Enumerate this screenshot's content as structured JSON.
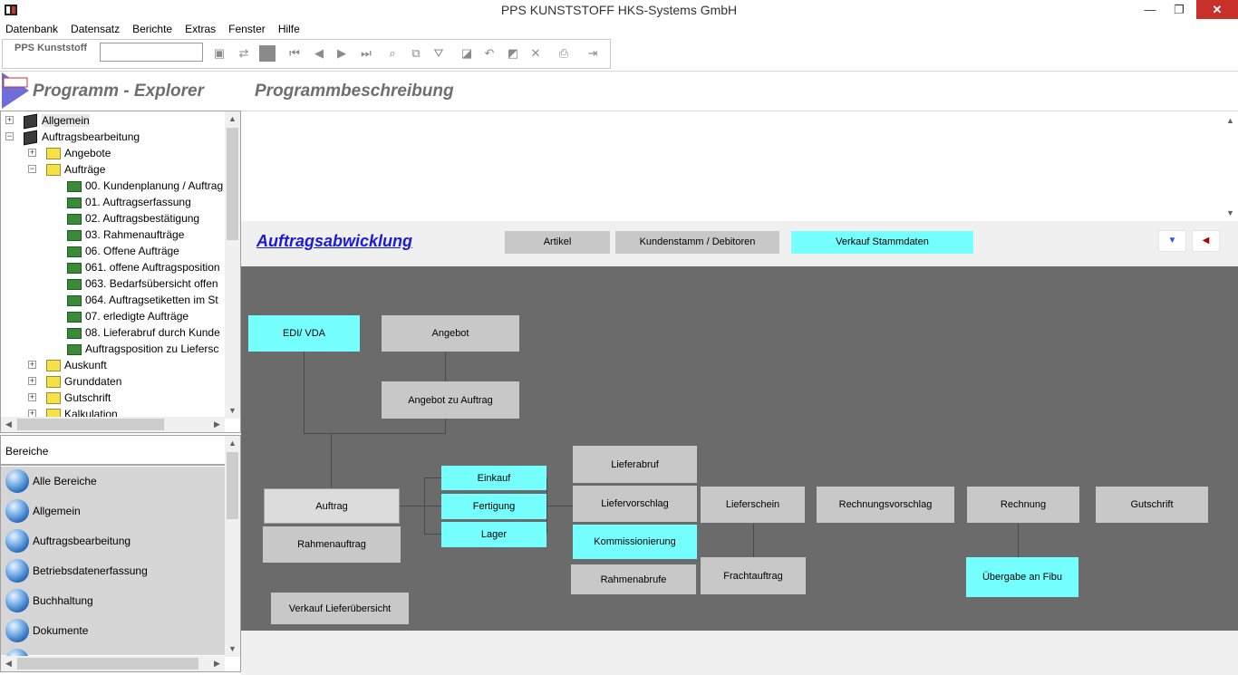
{
  "window": {
    "title": "PPS KUNSTSTOFF HKS-Systems GmbH",
    "minimize": "—",
    "maximize": "❐",
    "close": "✕"
  },
  "menu": [
    "Datenbank",
    "Datensatz",
    "Berichte",
    "Extras",
    "Fenster",
    "Hilfe"
  ],
  "toolbar": {
    "label": "PPS Kunststoff",
    "input_value": ""
  },
  "header": {
    "explorer_title": "Programm - Explorer",
    "description_title": "Programmbeschreibung"
  },
  "tree": [
    {
      "label": "Allgemein",
      "level": 0,
      "expander": "+",
      "icon": "book-icon",
      "selected": true
    },
    {
      "label": "Auftragsbearbeitung",
      "level": 0,
      "expander": "−",
      "icon": "book-icon"
    },
    {
      "label": "Angebote",
      "level": 1,
      "expander": "+",
      "icon": "folder-icon"
    },
    {
      "label": "Aufträge",
      "level": 1,
      "expander": "−",
      "icon": "folder-icon"
    },
    {
      "label": "00. Kundenplanung / Auftrag",
      "level": 2,
      "icon": "app-icon"
    },
    {
      "label": "01. Auftragserfassung",
      "level": 2,
      "icon": "app-icon"
    },
    {
      "label": "02. Auftragsbestätigung",
      "level": 2,
      "icon": "app-icon"
    },
    {
      "label": "03. Rahmenaufträge",
      "level": 2,
      "icon": "app-icon"
    },
    {
      "label": "06. Offene Aufträge",
      "level": 2,
      "icon": "app-icon"
    },
    {
      "label": "061. offene Auftragsposition",
      "level": 2,
      "icon": "app-icon"
    },
    {
      "label": "063. Bedarfsübersicht offen",
      "level": 2,
      "icon": "app-icon"
    },
    {
      "label": "064. Auftragsetiketten im St",
      "level": 2,
      "icon": "app-icon"
    },
    {
      "label": "07. erledigte Aufträge",
      "level": 2,
      "icon": "app-icon"
    },
    {
      "label": "08. Lieferabruf durch Kunde",
      "level": 2,
      "icon": "app-icon"
    },
    {
      "label": "Auftragsposition zu Liefersc",
      "level": 2,
      "icon": "app-icon"
    },
    {
      "label": "Auskunft",
      "level": 1,
      "expander": "+",
      "icon": "folder-icon"
    },
    {
      "label": "Grunddaten",
      "level": 1,
      "expander": "+",
      "icon": "folder-icon"
    },
    {
      "label": "Gutschrift",
      "level": 1,
      "expander": "+",
      "icon": "folder-icon"
    },
    {
      "label": "Kalkulation",
      "level": 1,
      "expander": "+",
      "icon": "folder-icon"
    }
  ],
  "bereiche": {
    "title": "Bereiche",
    "items": [
      "Alle Bereiche",
      "Allgemein",
      "Auftragsbearbeitung",
      "Betriebsdatenerfassung",
      "Buchhaltung",
      "Dokumente",
      ""
    ]
  },
  "diagram": {
    "title": "Auftragsabwicklung",
    "header_buttons": [
      {
        "label": "Artikel",
        "style": "gray"
      },
      {
        "label": "Kundenstamm / Debitoren",
        "style": "gray"
      },
      {
        "label": "Verkauf Stammdaten",
        "style": "cyan"
      }
    ],
    "nav_down_icon": "triangle-down-icon",
    "nav_left_icon": "triangle-left-icon",
    "nodes": {
      "edi_vda": "EDI/ VDA",
      "angebot": "Angebot",
      "angebot_zu_auftrag": "Angebot zu Auftrag",
      "auftrag": "Auftrag",
      "rahmenauftrag": "Rahmenauftrag",
      "verkauf_lieferuebersicht": "Verkauf Lieferübersicht",
      "einkauf": "Einkauf",
      "fertigung": "Fertigung",
      "lager": "Lager",
      "lieferabruf": "Lieferabruf",
      "liefervorschlag": "Liefervorschlag",
      "kommissionierung": "Kommissionierung",
      "rahmenabrufe": "Rahmenabrufe",
      "lieferschein": "Lieferschein",
      "frachtauftrag": "Frachtauftrag",
      "rechnungsvorschlag": "Rechnungsvorschlag",
      "rechnung": "Rechnung",
      "gutschrift": "Gutschrift",
      "uebergabe_fibu": "Übergabe an Fibu"
    }
  }
}
